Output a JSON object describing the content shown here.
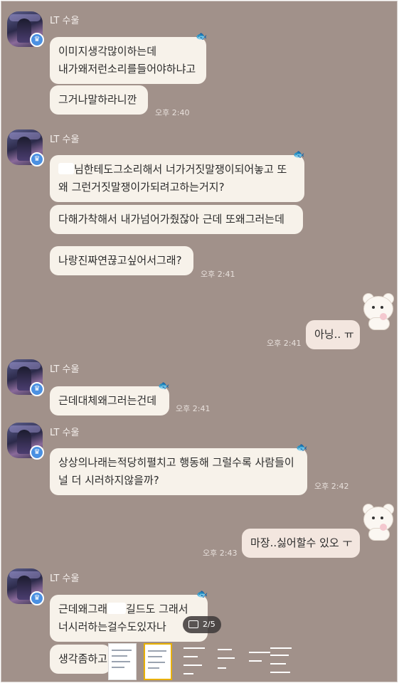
{
  "chat": {
    "sender": "LT 수울",
    "messages": [
      {
        "lines": [
          "이미지생각많이하는데",
          "내가왜저런소리를들어야하냐고"
        ]
      },
      {
        "lines": [
          "그거나말하라니깐"
        ],
        "time": "오후 2:40"
      },
      {
        "lines_pre": "",
        "line1_after_redact": "님한테도그소리해서 너가거짓말쟁이되어놓고 또",
        "line2": "왜 그런거짓말쟁이가되려고하는거지?"
      },
      {
        "lines": [
          "다해가착해서 내가넘어가줬잖아 근데 또왜그러는데"
        ]
      },
      {
        "lines": [
          "나랑진짜연끊고싶어서그래?"
        ],
        "time": "오후 2:41"
      },
      {
        "lines": [
          "아닝.. ㅠ"
        ],
        "time": "오후 2:41",
        "me": true
      },
      {
        "lines": [
          "근데대체왜그러는건데"
        ],
        "time": "오후 2:41"
      },
      {
        "lines": [
          "상상의나래는적당히펼치고 행동해 그럴수록 사람들이",
          "널 더 시러하지않을까?"
        ],
        "time": "오후 2:42"
      },
      {
        "lines": [
          "마장..싫어할수 있오 ㅜ"
        ],
        "time": "오후 2:43",
        "me": true
      },
      {
        "line1_before_redact": "근데왜그래",
        "line1_after_redact": "길드도 그래서",
        "line2": "너시러하는걸수도있자나"
      },
      {
        "lines": [
          "생각좀하고"
        ]
      }
    ]
  },
  "viewer": {
    "page_indicator": "2/5",
    "selected_thumb_index": 1,
    "thumb_count": 6
  },
  "icons": {
    "badge": "crown-badge-icon",
    "sticker": "fish-sticker-icon",
    "bear": "bear-profile-sticker"
  },
  "colors": {
    "background": "#a1918a",
    "bubble": "#f7f2ea",
    "badge": "#4a90e2"
  }
}
